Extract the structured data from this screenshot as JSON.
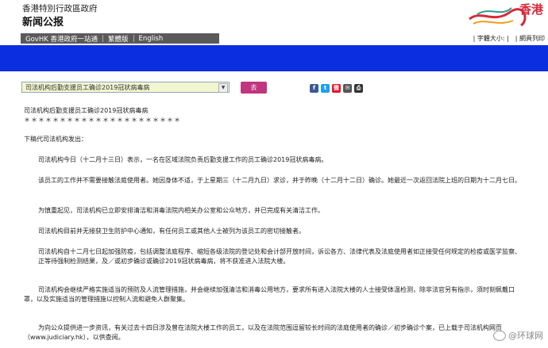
{
  "header": {
    "gov_name": "香港特別行政區政府",
    "site_title": "新闻公报",
    "logo_text": "香港"
  },
  "nav": {
    "items": [
      "GovHK 香港政府一站通",
      "繁體版",
      "English"
    ],
    "font_size_label": "| 字體大小: |",
    "print_label": "| 網頁列印"
  },
  "toolbar": {
    "select_value": "司法机构后勤支援员工确诊2019冠状病毒病",
    "go_label": "去"
  },
  "share_icons": [
    {
      "name": "facebook-icon",
      "glyph": "f",
      "color": "#3b5998"
    },
    {
      "name": "twitter-icon",
      "glyph": "t",
      "color": "#1da1f2"
    },
    {
      "name": "weibo-icon",
      "glyph": "微",
      "color": "#e6162d"
    },
    {
      "name": "email-icon",
      "glyph": "✉",
      "color": "#555555"
    },
    {
      "name": "print-icon",
      "glyph": "⎙",
      "color": "#333333"
    }
  ],
  "article": {
    "title": "司法机构后勤支援员工确诊2019冠状病毒病",
    "stars": "＊＊＊＊＊＊＊＊＊＊＊＊＊＊＊＊＊＊＊＊＊＊",
    "intro": "下稿代司法机构发出：",
    "paragraphs": [
      "司法机构今日（十二月十三日）表示，一名在区域法院负责后勤支援工作的员工确诊2019冠状病毒病。",
      "该员工的工作并不需要接触法庭使用者。她因身体不适，于上星期三（十二月九日）求诊，并于昨晚（十二月十二日）确诊。她最近一次返回法院上班的日期为十二月七日。",
      "为慎重起见，司法机构已立即安排清洁和消毒法院内相关办公室和公众地方，并已完成有关清洁工作。",
      "司法机构目前并无接获卫生防护中心通知，有任何员工或其他人士被列为该员工的密切接触者。",
      "司法机构自十二月七日起加强防疫，包括调整法庭程序、缩短各级法院的登记处和会计部开放时间，诉讼各方、法律代表及法庭使用者如正接受任何规定的检疫或医学监察、正等待强制检测结果，及／或初步确诊或确诊2019冠状病毒病，将不获准进入法院大楼。",
      "司法机构会继续严格实施适当的预防及人流管理措施，并会继续加强清洁和消毒公用地方，要求所有进入法院大楼的人士接受体温检测，除非法官另有指示，须时刻佩戴口罩，以及实施适当的管理措施以控制人流和避免人群聚集。",
      "为向公众提供进一步资讯，有关过去十四日涉及曾在法院大楼工作的员工，以及在法院范围逗留较长时间的法庭使用者的确诊／初步确诊个案，已上载于司法机构网页（www.judiciary.hk），以供查阅。"
    ]
  },
  "watermark": "@环球网"
}
